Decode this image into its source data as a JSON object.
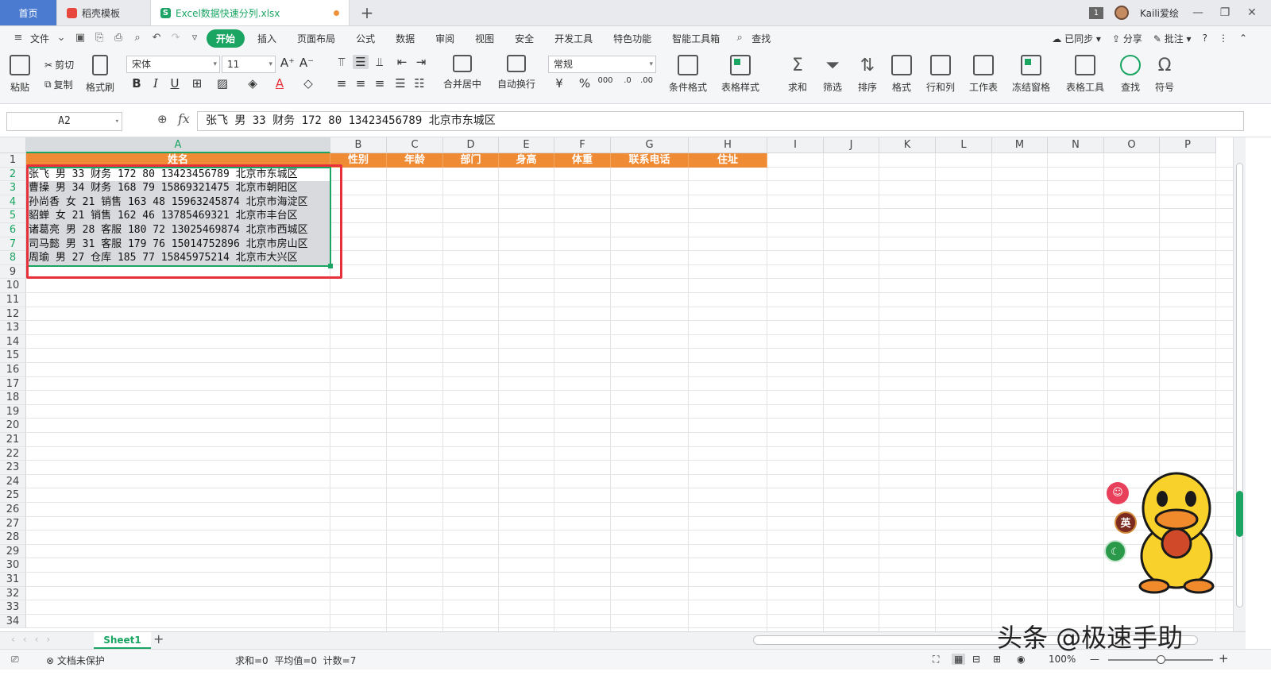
{
  "tabs": {
    "home": "首页",
    "templates": "稻壳模板",
    "file": "Excel数据快速分列.xlsx",
    "page_count": "1",
    "user": "Kaili爱绘"
  },
  "menu": {
    "file": "文件",
    "items": [
      "开始",
      "插入",
      "页面布局",
      "公式",
      "数据",
      "审阅",
      "视图",
      "安全",
      "开发工具",
      "特色功能",
      "智能工具箱"
    ],
    "search": "查找",
    "sync": "已同步",
    "share": "分享",
    "comment": "批注"
  },
  "ribbon": {
    "paste": "粘贴",
    "cut": "剪切",
    "copy": "复制",
    "format_painter": "格式刷",
    "font": "宋体",
    "font_size": "11",
    "merge": "合并居中",
    "wrap": "自动换行",
    "number_format": "常规",
    "cond_format": "条件格式",
    "table_style": "表格样式",
    "sum": "求和",
    "filter": "筛选",
    "sort": "排序",
    "format": "格式",
    "rowcol": "行和列",
    "worksheet": "工作表",
    "freeze": "冻结窗格",
    "table_tools": "表格工具",
    "find": "查找",
    "symbol": "符号"
  },
  "formula_bar": {
    "cell_ref": "A2",
    "fx": "fx",
    "content": "张飞 男 33 财务 172 80 13423456789 北京市东城区"
  },
  "columns": [
    "A",
    "B",
    "C",
    "D",
    "E",
    "F",
    "G",
    "H",
    "I",
    "J",
    "K",
    "L",
    "M",
    "N",
    "O",
    "P"
  ],
  "rows": [
    "1",
    "2",
    "3",
    "4",
    "5",
    "6",
    "7",
    "8",
    "9",
    "10",
    "11",
    "12",
    "13",
    "14",
    "15",
    "16",
    "17",
    "18",
    "19",
    "20",
    "21",
    "22",
    "23",
    "24",
    "25",
    "26",
    "27",
    "28",
    "29",
    "30",
    "31",
    "32",
    "33",
    "34"
  ],
  "header_row": [
    "姓名",
    "性别",
    "年龄",
    "部门",
    "身高",
    "体重",
    "联系电话",
    "住址"
  ],
  "data_rows": [
    "张飞 男 33 财务 172 80 13423456789 北京市东城区",
    "曹操 男 34 财务 168 79 15869321475 北京市朝阳区",
    "孙尚香 女 21 销售 163 48 15963245874 北京市海淀区",
    "貂蝉 女 21 销售 162 46 13785469321 北京市丰台区",
    "诸葛亮 男 28 客服 180 72 13025469874 北京市西城区",
    "司马懿 男 31 客服 179 76 15014752896 北京市房山区",
    "周瑜 男 27 仓库 185 77 15845975214 北京市大兴区"
  ],
  "sheet_tab": "Sheet1",
  "status": {
    "protect": "文档未保护",
    "stats": "求和=0  平均值=0  计数=7",
    "zoom": "100%"
  },
  "float": {
    "lang": "英"
  },
  "watermark": "头条 @极速手助",
  "colors": {
    "accent_green": "#1ba563",
    "header_orange": "#ef8a35",
    "highlight_red": "#e8303a"
  }
}
